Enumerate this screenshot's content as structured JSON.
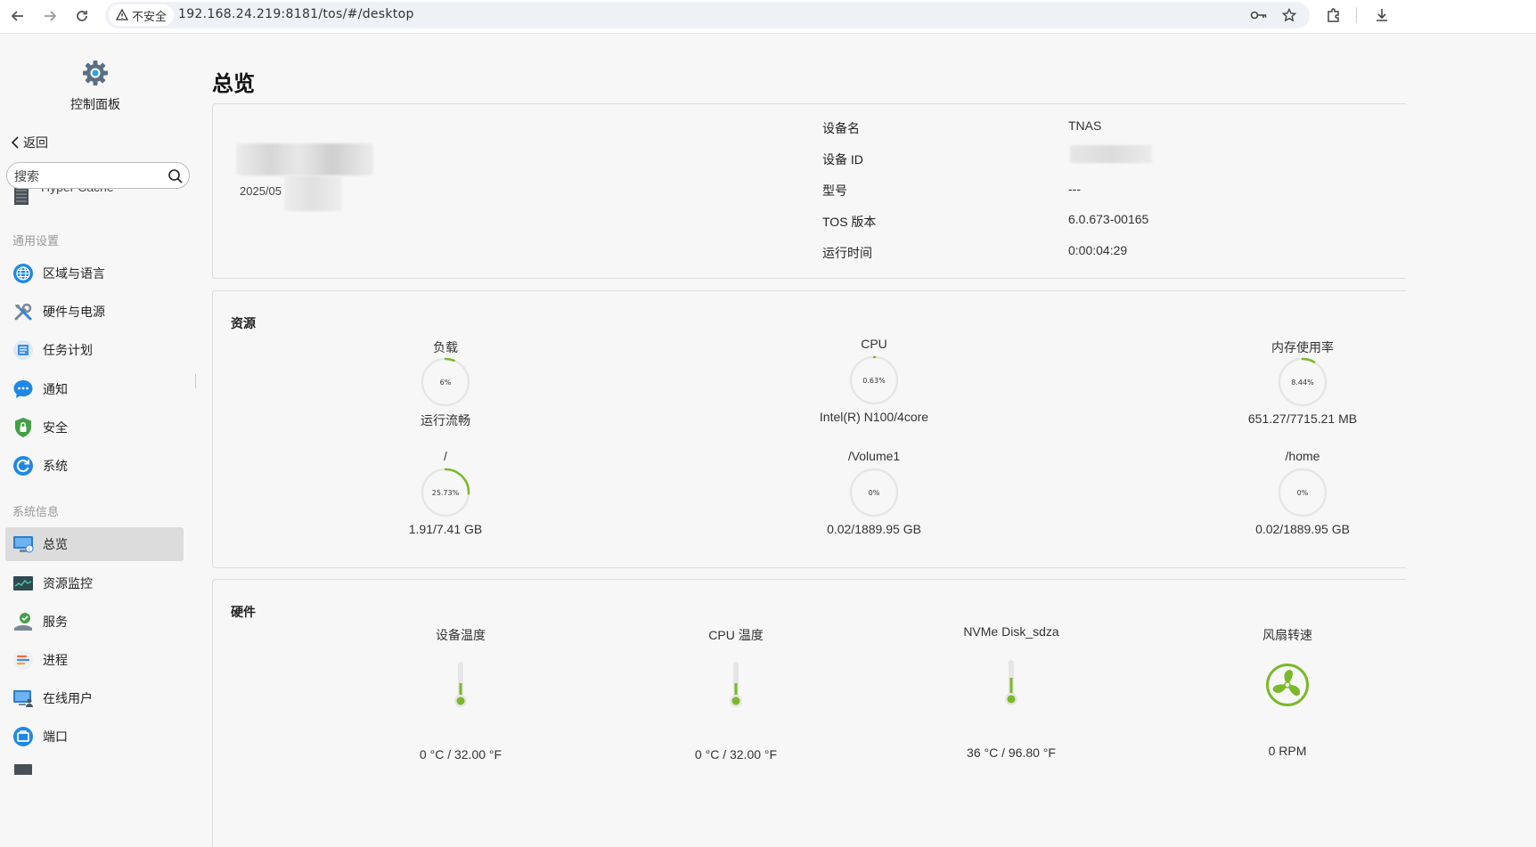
{
  "browser": {
    "security_label": "不安全",
    "url": "192.168.24.219:8181/tos/#/desktop"
  },
  "sidebar": {
    "app_title": "控制面板",
    "back_label": "返回",
    "search_placeholder": "搜索",
    "partial_item": "Hyper Cache",
    "section_general": "通用设置",
    "general_items": [
      {
        "label": "区域与语言",
        "icon": "globe-icon"
      },
      {
        "label": "硬件与电源",
        "icon": "tools-icon"
      },
      {
        "label": "任务计划",
        "icon": "task-list-icon"
      },
      {
        "label": "通知",
        "icon": "chat-bubble-icon"
      },
      {
        "label": "安全",
        "icon": "shield-icon"
      },
      {
        "label": "系统",
        "icon": "refresh-icon"
      }
    ],
    "section_sysinfo": "系统信息",
    "sysinfo_items": [
      {
        "label": "总览",
        "icon": "monitor-icon",
        "active": true
      },
      {
        "label": "资源监控",
        "icon": "chart-monitor-icon"
      },
      {
        "label": "服务",
        "icon": "service-icon"
      },
      {
        "label": "进程",
        "icon": "process-icon"
      },
      {
        "label": "在线用户",
        "icon": "user-monitor-icon"
      },
      {
        "label": "端口",
        "icon": "port-icon"
      }
    ]
  },
  "main": {
    "title": "总览",
    "device": {
      "date_partial": "2025/05",
      "rows": [
        {
          "label": "设备名",
          "value": "TNAS"
        },
        {
          "label": "设备 ID",
          "value": ""
        },
        {
          "label": "型号",
          "value": "---"
        },
        {
          "label": "TOS 版本",
          "value": "6.0.673-00165"
        },
        {
          "label": "运行时间",
          "value": "0:00:04:29"
        }
      ]
    },
    "resources": {
      "title": "资源",
      "gauges": [
        {
          "label": "负载",
          "value_text": "6%",
          "fraction": 0.06,
          "sub": "运行流畅"
        },
        {
          "label": "CPU",
          "value_text": "0.63%",
          "fraction": 0.0063,
          "sub": "Intel(R) N100/4core"
        },
        {
          "label": "内存使用率",
          "value_text": "8.44%",
          "fraction": 0.0844,
          "sub": "651.27/7715.21 MB"
        },
        {
          "label": "/",
          "value_text": "25.73%",
          "fraction": 0.2573,
          "sub": "1.91/7.41 GB"
        },
        {
          "label": "/Volume1",
          "value_text": "0%",
          "fraction": 0,
          "sub": "0.02/1889.95 GB"
        },
        {
          "label": "/home",
          "value_text": "0%",
          "fraction": 0,
          "sub": "0.02/1889.95 GB"
        }
      ]
    },
    "hardware": {
      "title": "硬件",
      "items": [
        {
          "label": "设备温度",
          "value": "0 °C / 32.00 °F",
          "type": "thermometer"
        },
        {
          "label": "CPU 温度",
          "value": "0 °C / 32.00 °F",
          "type": "thermometer"
        },
        {
          "label": "NVMe Disk_sdza",
          "value": "36 °C / 96.80 °F",
          "type": "thermometer"
        },
        {
          "label": "风扇转速",
          "value": "0 RPM",
          "type": "fan"
        }
      ]
    }
  },
  "colors": {
    "accent_green": "#7ab929",
    "gauge_track": "#e6e6e6"
  }
}
